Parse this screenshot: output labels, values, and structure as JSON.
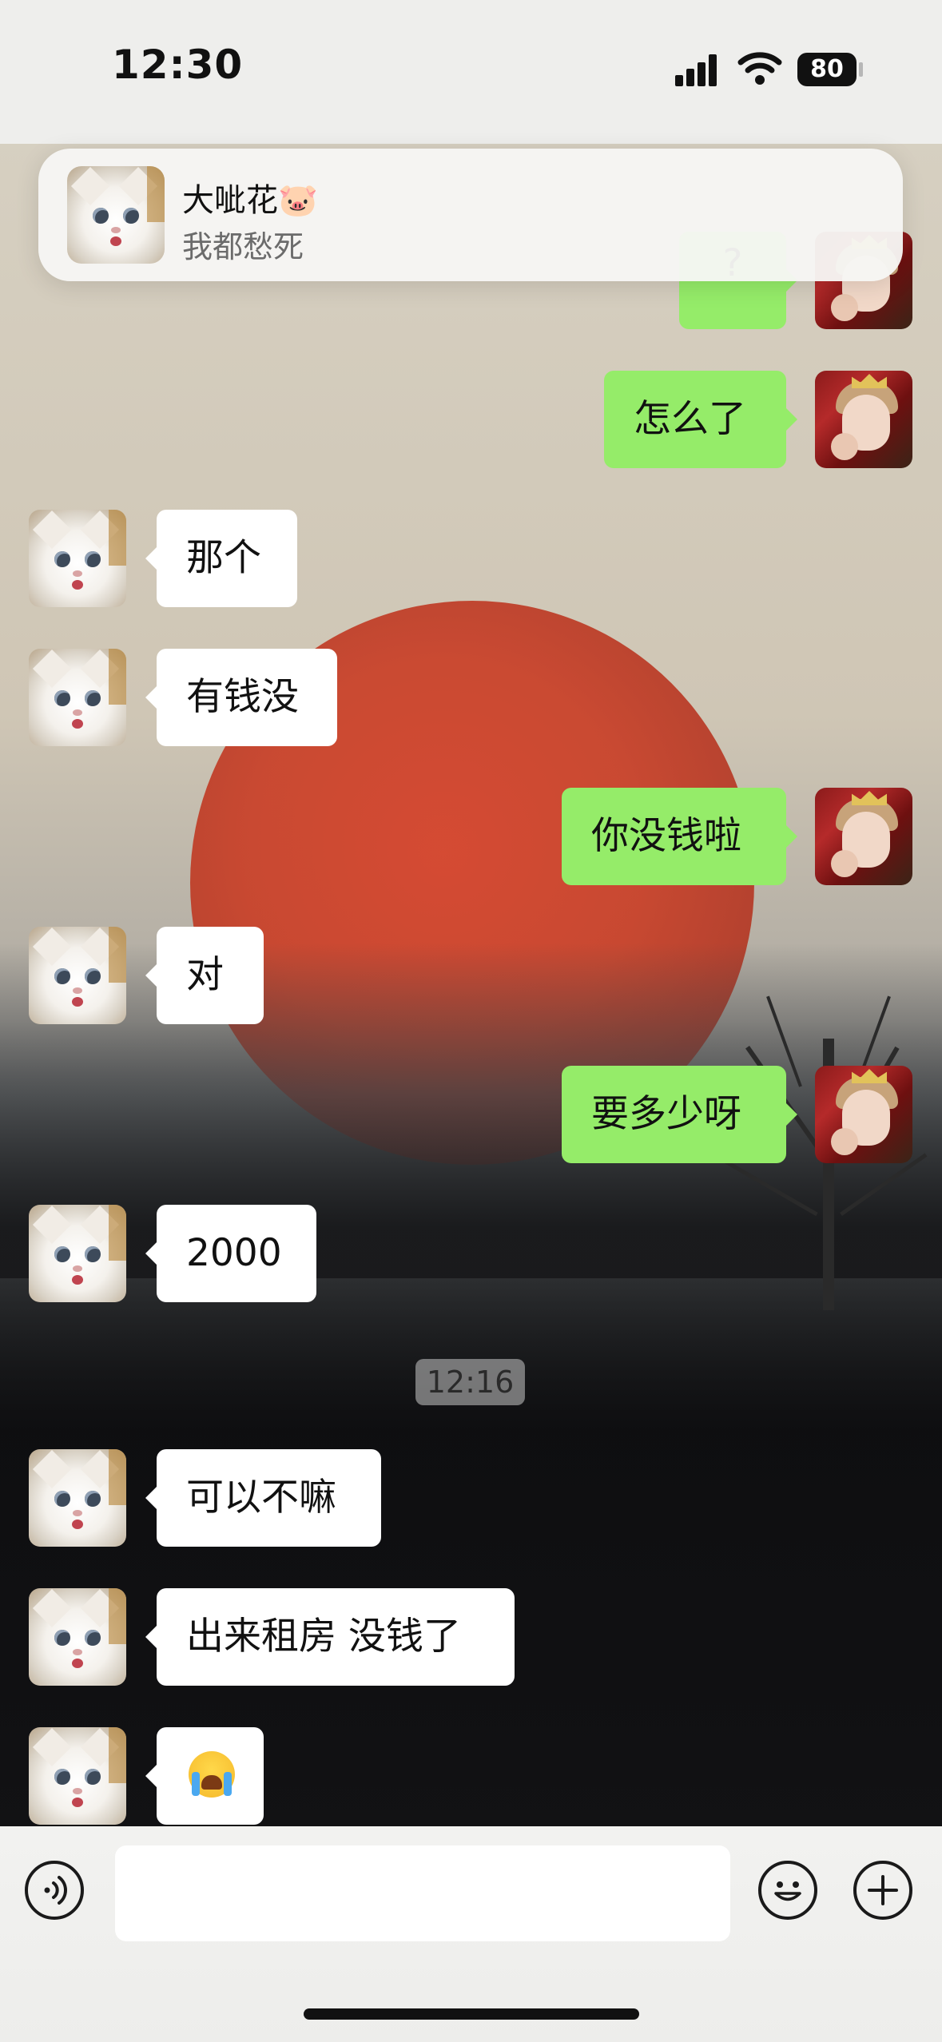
{
  "status_bar": {
    "time": "12:30",
    "battery": "80"
  },
  "notification": {
    "title": "大呲花🐷",
    "body": "我都愁死"
  },
  "messages": [
    {
      "side": "right",
      "text": "怎么了"
    },
    {
      "side": "left",
      "text": "那个"
    },
    {
      "side": "left",
      "text": "有钱没"
    },
    {
      "side": "right",
      "text": "你没钱啦"
    },
    {
      "side": "left",
      "text": "对"
    },
    {
      "side": "right",
      "text": "要多少呀"
    },
    {
      "side": "left",
      "text": "2000"
    },
    {
      "side": "left",
      "text": "可以不嘛"
    },
    {
      "side": "left",
      "text": "出来租房 没钱了"
    },
    {
      "side": "left",
      "emoji": "loudly-crying-face"
    }
  ],
  "timestamp": "12:16",
  "partial_bubble_text": "?",
  "input_bar": {
    "voice_icon": "voice-icon",
    "emoji_icon": "emoji-icon",
    "plus_icon": "plus-icon",
    "input_value": ""
  }
}
